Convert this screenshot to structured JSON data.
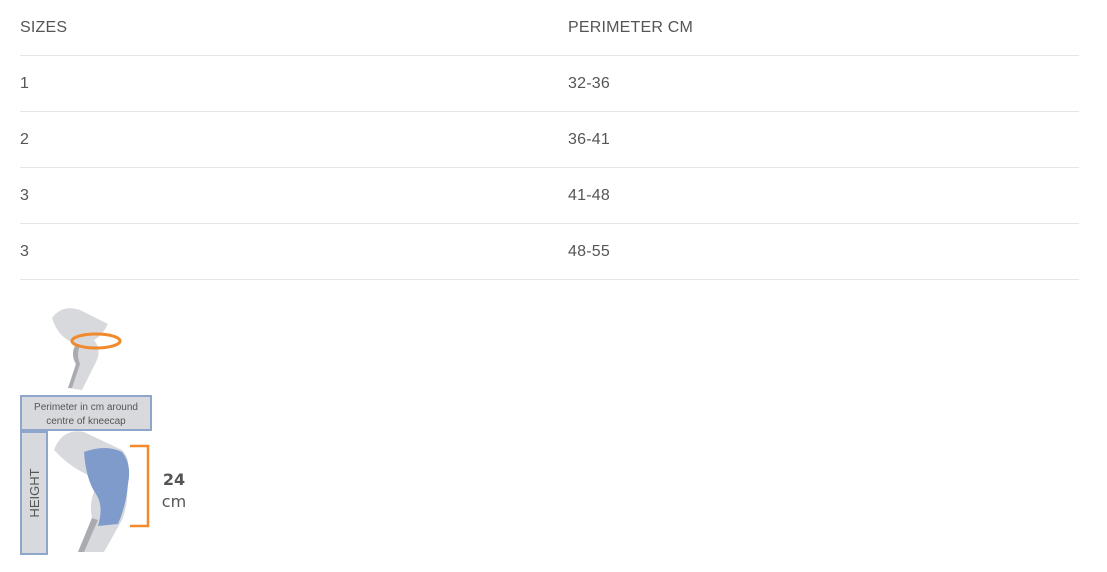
{
  "table": {
    "headers": {
      "size": "SIZES",
      "perimeter": "PERIMETER CM"
    },
    "rows": [
      {
        "size": "1",
        "perimeter": "32-36"
      },
      {
        "size": "2",
        "perimeter": "36-41"
      },
      {
        "size": "3",
        "perimeter": "41-48"
      },
      {
        "size": "3",
        "perimeter": "48-55"
      }
    ]
  },
  "diagram": {
    "perimeter_caption_line1": "Perimeter in cm around",
    "perimeter_caption_line2": "centre of kneecap",
    "height_label": "HEIGHT",
    "height_value": "24",
    "height_unit": "cm",
    "colors": {
      "leg": "#d8d9dc",
      "leg_shadow": "#a9abb0",
      "brace": "#7f9bcb",
      "measure": "#f08a2c",
      "caption_border": "#8fa6cc"
    }
  }
}
